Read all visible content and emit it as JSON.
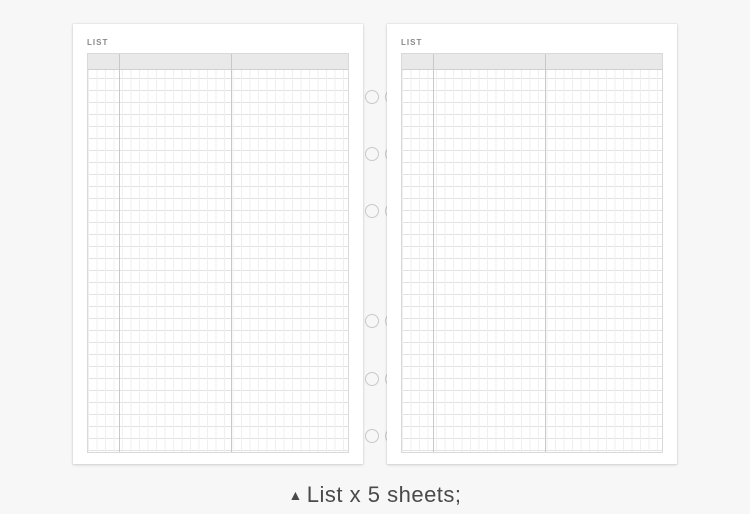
{
  "top_fragment": "",
  "page_label": "LIST",
  "caption_marker": "▲",
  "caption_text": "List  x 5 sheets;",
  "hole_positions_pct": [
    15,
    28,
    41,
    66,
    79,
    92
  ]
}
